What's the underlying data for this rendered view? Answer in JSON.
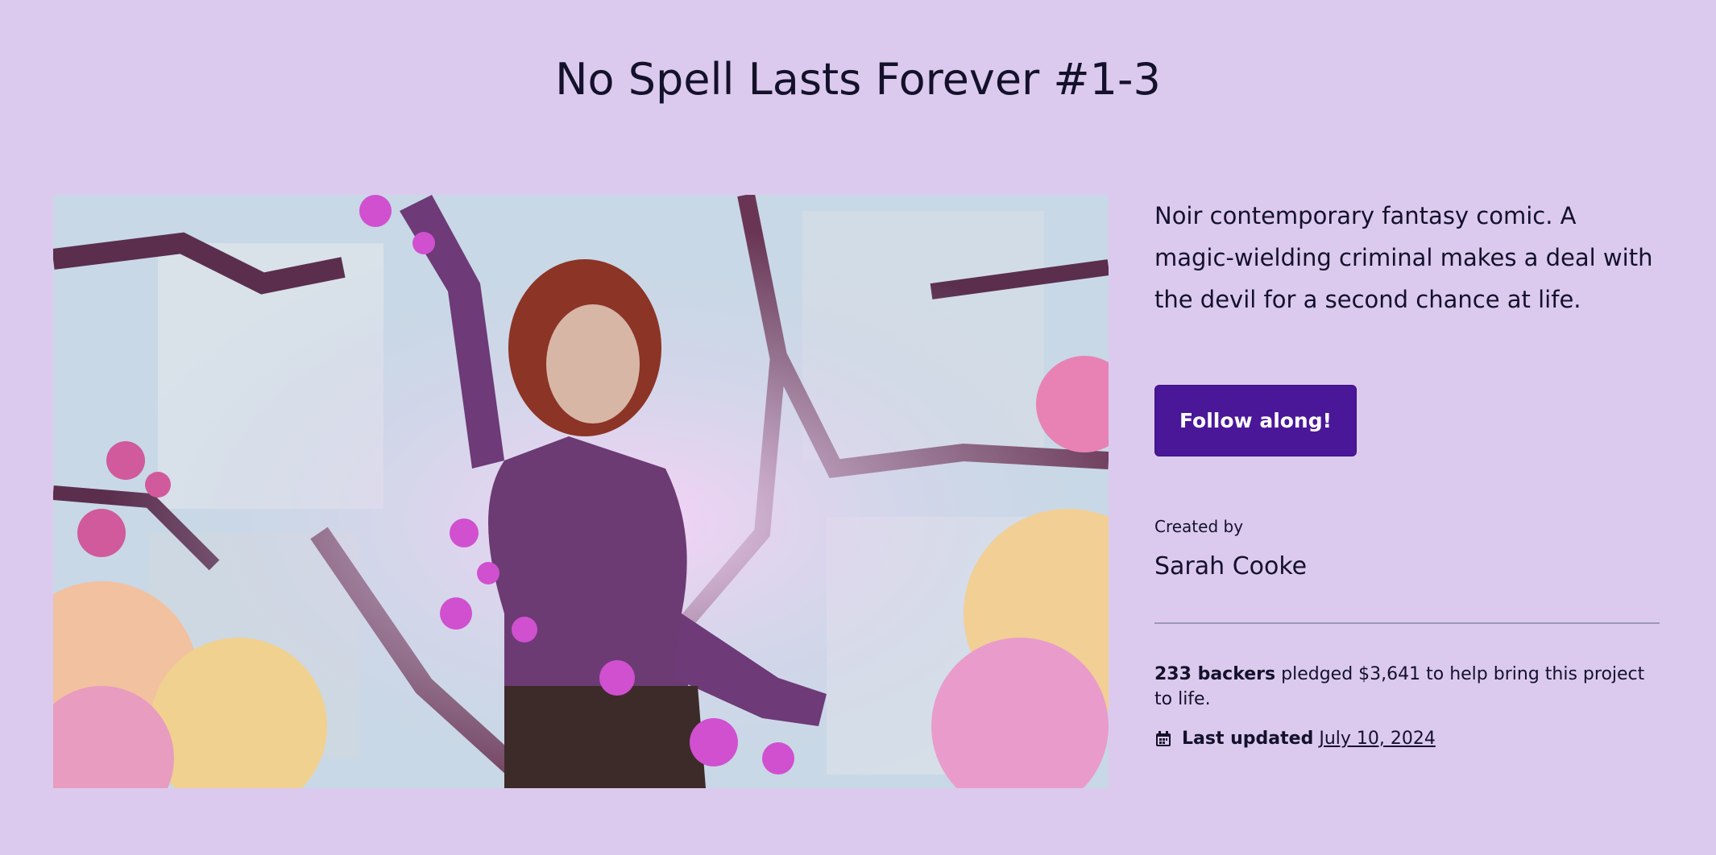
{
  "page": {
    "title": "No Spell Lasts Forever #1-3"
  },
  "project": {
    "description": "Noir contemporary fantasy comic. A magic-wielding criminal makes a deal with the devil for a second chance at life.",
    "follow_label": "Follow along!",
    "created_by_label": "Created by",
    "creator_name": "Sarah Cooke",
    "backers_count": "233 backers",
    "pledge_text": " pledged $3,641 to help bring this project to life.",
    "last_updated_label": "Last updated",
    "last_updated_date": "July 10, 2024"
  },
  "icons": {
    "calendar": "calendar-icon"
  },
  "colors": {
    "background": "#dccaee",
    "button": "#4a1799",
    "text": "#14112b"
  }
}
